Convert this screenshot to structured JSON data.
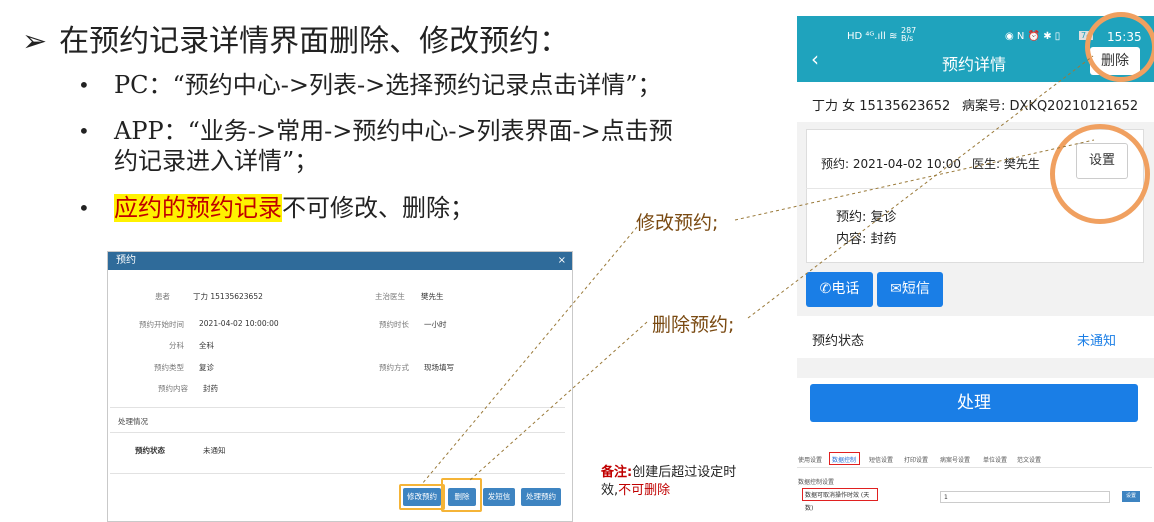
{
  "slide": {
    "title": "在预约记录详情界面删除、修改预约：",
    "title_arrow": "➢",
    "bullets": [
      "PC：“预约中心->列表->选择预约记录点击详情”；",
      "APP：“业务->常用->预约中心->列表界面->点击预",
      "约记录进入详情”；",
      "不可修改、删除；"
    ],
    "bullet_highlight": "应约的预约记录",
    "bullet_dot": "•"
  },
  "pc_dialog": {
    "title": "预约",
    "close": "×",
    "fields": [
      {
        "label": "患者",
        "value": "丁力 15135623652"
      },
      {
        "label": "主治医生",
        "value": "樊先生"
      },
      {
        "label": "预约开始时间",
        "value": "2021-04-02 10:00:00"
      },
      {
        "label": "预约时长",
        "value": "一小时"
      },
      {
        "label": "分科",
        "value": "全科"
      },
      {
        "label": "预约类型",
        "value": "复诊"
      },
      {
        "label": "预约方式",
        "value": "现场填写"
      },
      {
        "label": "预约内容",
        "value": "封药"
      }
    ],
    "section": "处理情况",
    "status_label": "预约状态",
    "status_value": "未通知",
    "buttons": {
      "edit": "修改预约",
      "delete": "删除",
      "sms": "发短信",
      "process": "处理预约"
    }
  },
  "annotations": {
    "edit": "修改预约;",
    "delete": "删除预约;"
  },
  "note": {
    "label": "备注:",
    "text1": "创建后超过设定时",
    "text2_prefix": "效,",
    "text2_red": "不可删除"
  },
  "phone": {
    "status": {
      "speed_top": "287",
      "speed_bottom": "B/s",
      "signal": "HD ⁴ᴳ.ıll ≋",
      "right_icons": "◉ N ⏰ ✱ ▯",
      "battery": "74",
      "time": "15:35"
    },
    "nav_title": "预约详情",
    "delete_btn": "删除",
    "patient": "丁力 女 15135623652",
    "record_no": "病案号: DXKQ20210121652",
    "appointment": "预约: 2021-04-02 10:00",
    "doctor": "医生: 樊先生",
    "settings_btn": "设置",
    "type_line": "预约: 复诊",
    "content_line": "内容: 封药",
    "call_btn": "电话",
    "sms_btn": "短信",
    "status_label": "预约状态",
    "status_value": "未通知",
    "process_btn": "处理"
  },
  "settings": {
    "tabs": [
      "使用设置",
      "数据控制",
      "短信设置",
      "打印设置",
      "病案号设置",
      "单位设置",
      "范文设置"
    ],
    "section": "数据控制设置",
    "field_label": "数据可取消操作时效 (天数)",
    "field_value": "1",
    "save": "设置"
  },
  "colors": {
    "teal": "#1fa3bd",
    "blue_btn": "#1a7ee6",
    "orange": "#f0a060",
    "highlight": "#fff200",
    "red": "#c00000"
  }
}
